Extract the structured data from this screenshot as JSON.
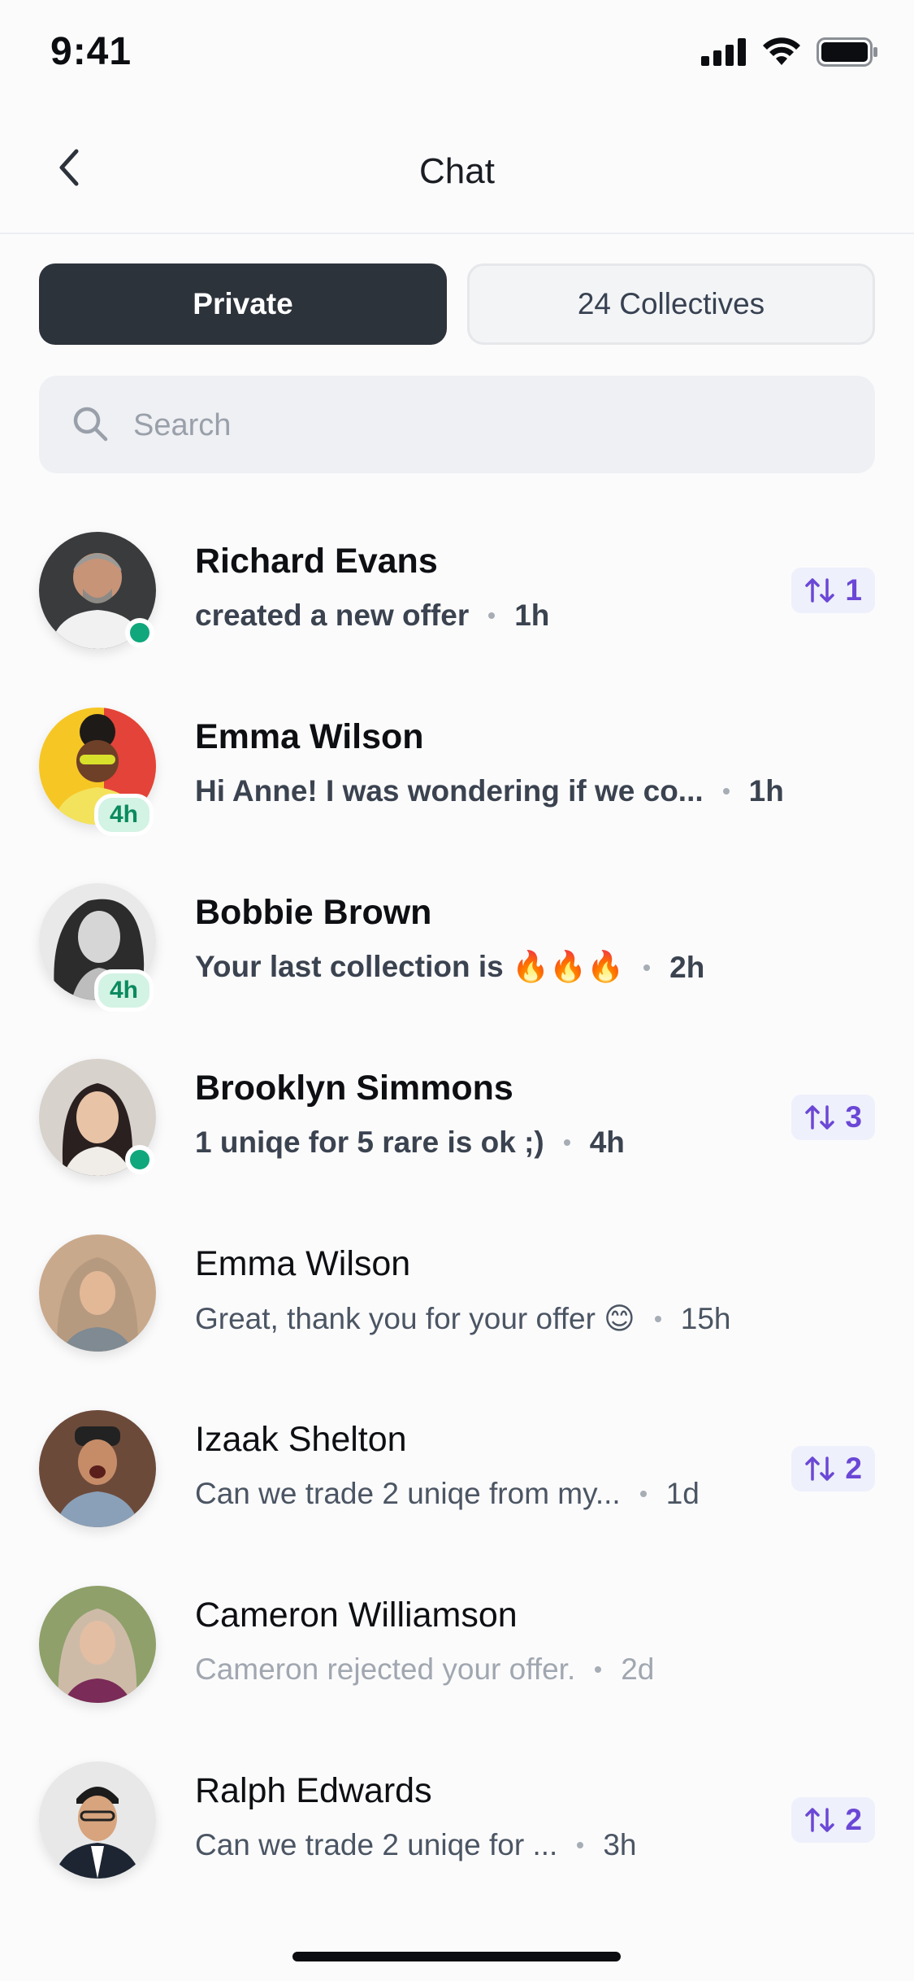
{
  "status": {
    "time": "9:41"
  },
  "nav": {
    "title": "Chat"
  },
  "tabs": {
    "private": "Private",
    "collectives": "24 Collectives"
  },
  "search": {
    "placeholder": "Search"
  },
  "chats": [
    {
      "name": "Richard Evans",
      "message": "created a new offer",
      "ago": "1h",
      "badge": "1",
      "style": "bold",
      "status": "online"
    },
    {
      "name": "Emma Wilson",
      "message": "Hi Anne! I was wondering if we co...",
      "ago": "1h",
      "badge": "",
      "style": "bold",
      "status": "4h"
    },
    {
      "name": "Bobbie Brown",
      "message": "Your last collection is 🔥🔥🔥",
      "ago": "2h",
      "badge": "",
      "style": "bold",
      "status": "4h"
    },
    {
      "name": "Brooklyn Simmons",
      "message": "1 uniqe for 5 rare is ok ;)",
      "ago": "4h",
      "badge": "3",
      "style": "bold",
      "status": "online"
    },
    {
      "name": "Emma Wilson",
      "message": "Great, thank you for your offer 😊",
      "ago": "15h",
      "badge": "",
      "style": "normal",
      "status": ""
    },
    {
      "name": "Izaak Shelton",
      "message": "Can we trade 2 uniqe from my...",
      "ago": "1d",
      "badge": "2",
      "style": "normal",
      "status": ""
    },
    {
      "name": "Cameron Williamson",
      "message": "Cameron rejected your offer.",
      "ago": "2d",
      "badge": "",
      "style": "muted",
      "status": ""
    },
    {
      "name": "Ralph Edwards",
      "message": "Can we trade 2 uniqe for ...",
      "ago": "3h",
      "badge": "2",
      "style": "normal",
      "status": ""
    }
  ],
  "colors": {
    "accent": "#6b47d6",
    "online": "#10a77c",
    "tab_active": "#2d333b"
  }
}
